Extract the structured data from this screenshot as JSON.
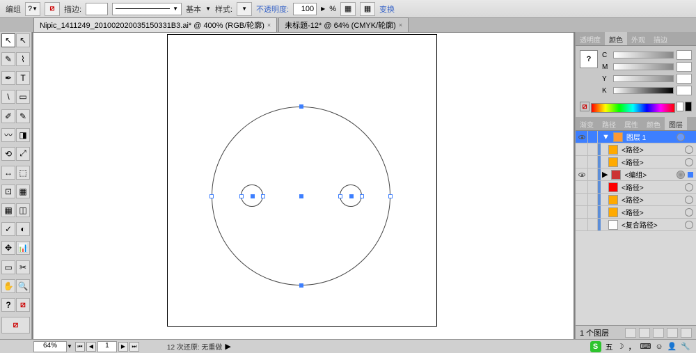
{
  "top_toolbar": {
    "group_label": "编组",
    "q_mark": "?",
    "stroke_label": "描边:",
    "basic_label": "基本",
    "style_label": "样式:",
    "opacity_label": "不透明度:",
    "opacity_value": "100",
    "percent": "%",
    "transform_label": "变换"
  },
  "doc_tabs": [
    {
      "name": "Nipic_1411249_201002020035150331B3.ai* @ 400% (RGB/轮廓)"
    },
    {
      "name": "未标题-12* @ 64% (CMYK/轮廓)"
    }
  ],
  "right_panel_tabs_top": [
    "透明度",
    "颜色",
    "外观",
    "描边"
  ],
  "right_panel_tabs_mid": [
    "渐变",
    "路径",
    "属性",
    "颜色",
    "图层"
  ],
  "cmyk": {
    "labels": [
      "C",
      "M",
      "Y",
      "K"
    ]
  },
  "layers_panel": {
    "title": "图层 1",
    "items": [
      {
        "name": "<路径>",
        "color": "#ffaa00"
      },
      {
        "name": "<路径>",
        "color": "#ffaa00"
      },
      {
        "name": "<编组>",
        "color": "#cc3333"
      },
      {
        "name": "<路径>",
        "color": "#ff0000"
      },
      {
        "name": "<路径>",
        "color": "#ffaa00"
      },
      {
        "name": "<路径>",
        "color": "#ffaa00"
      },
      {
        "name": "<复合路径>",
        "color": "#fff"
      }
    ],
    "count_text": "1 个图层"
  },
  "bottom": {
    "zoom": "64%",
    "page": "1",
    "status": "12 次还原: 无重做",
    "ime_text": "五"
  },
  "tools": [
    "↖",
    "⬚",
    "✎",
    "T",
    "\\",
    "⬜",
    "✐",
    "〰",
    "⟲",
    "↔",
    "⊡",
    "▦",
    "〜",
    "⬚",
    "⬭",
    "📊",
    "✂",
    "◫",
    "⟋",
    "⬛",
    "⬚",
    "✥",
    "◐",
    "⊚",
    "▭",
    "⚲",
    "▤",
    "◫",
    "◢",
    "🔍",
    "⬚",
    "✋",
    "?",
    "⬚"
  ]
}
